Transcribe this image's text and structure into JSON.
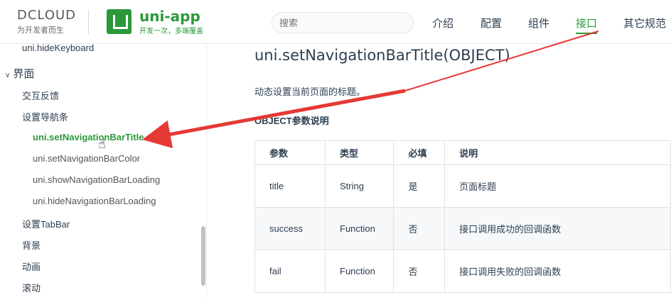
{
  "header": {
    "dcloud_brand": "DCLOUD",
    "dcloud_slogan": "为开发者而生",
    "app_name": "uni-app",
    "app_slogan": "开发一次，多端覆盖",
    "search_placeholder": "搜索",
    "nav": [
      "介绍",
      "配置",
      "组件",
      "接口",
      "其它规范"
    ],
    "active_nav": "接口",
    "brand_color": "#2b9939"
  },
  "sidebar": {
    "prev_item": "uni.hideKeyboard",
    "group": "界面",
    "sub1": "交互反馈",
    "sub2": "设置导航条",
    "items": [
      "uni.setNavigationBarTitle",
      "uni.setNavigationBarColor",
      "uni.showNavigationBarLoading",
      "uni.hideNavigationBarLoading"
    ],
    "after": [
      "设置TabBar",
      "背景",
      "动画",
      "滚动"
    ]
  },
  "main": {
    "title": "uni.setNavigationBarTitle(OBJECT)",
    "description": "动态设置当前页面的标题。",
    "subheading": "OBJECT参数说明",
    "table": {
      "headers": [
        "参数",
        "类型",
        "必填",
        "说明"
      ],
      "rows": [
        [
          "title",
          "String",
          "是",
          "页面标题"
        ],
        [
          "success",
          "Function",
          "否",
          "接口调用成功的回调函数"
        ],
        [
          "fail",
          "Function",
          "否",
          "接口调用失败的回调函数"
        ]
      ]
    }
  },
  "annotation_color": "#e53935"
}
